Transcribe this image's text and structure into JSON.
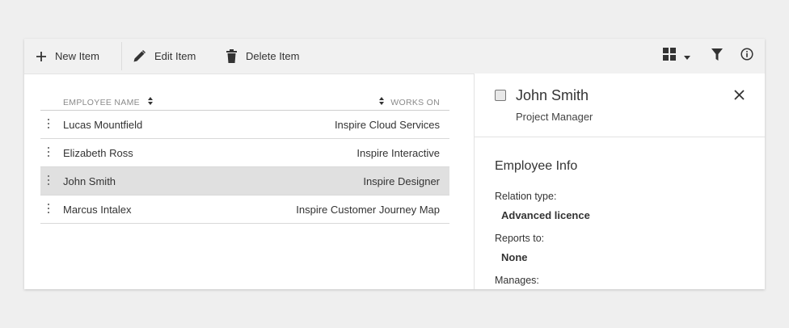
{
  "toolbar": {
    "new_label": "New Item",
    "edit_label": "Edit Item",
    "delete_label": "Delete Item"
  },
  "table": {
    "columns": {
      "name": "EMPLOYEE NAME",
      "works_on": "WORKS ON"
    },
    "rows": [
      {
        "name": "Lucas Mountfield",
        "works_on": "Inspire Cloud Services"
      },
      {
        "name": "Elizabeth Ross",
        "works_on": "Inspire Interactive"
      },
      {
        "name": "John Smith",
        "works_on": "Inspire Designer"
      },
      {
        "name": "Marcus Intalex",
        "works_on": "Inspire Customer Journey Map"
      }
    ],
    "selected_index": 2
  },
  "detail": {
    "title": "John Smith",
    "subtitle": "Project Manager",
    "section_title": "Employee Info",
    "fields": [
      {
        "label": "Relation type:",
        "value": "Advanced licence"
      },
      {
        "label": "Reports to:",
        "value": "None"
      },
      {
        "label": "Manages:",
        "value": ""
      }
    ]
  },
  "colors": {
    "background": "#efefef",
    "toolbar": "#f1f1f1",
    "selected_row": "#e0e0e0",
    "icon": "#333333"
  },
  "icons": {
    "new": "plus-icon",
    "edit": "pencil-icon",
    "delete": "trash-icon",
    "view": "grid-icon",
    "dropdown": "caret-down-icon",
    "filter": "filter-icon",
    "info": "info-icon",
    "close": "close-icon"
  }
}
